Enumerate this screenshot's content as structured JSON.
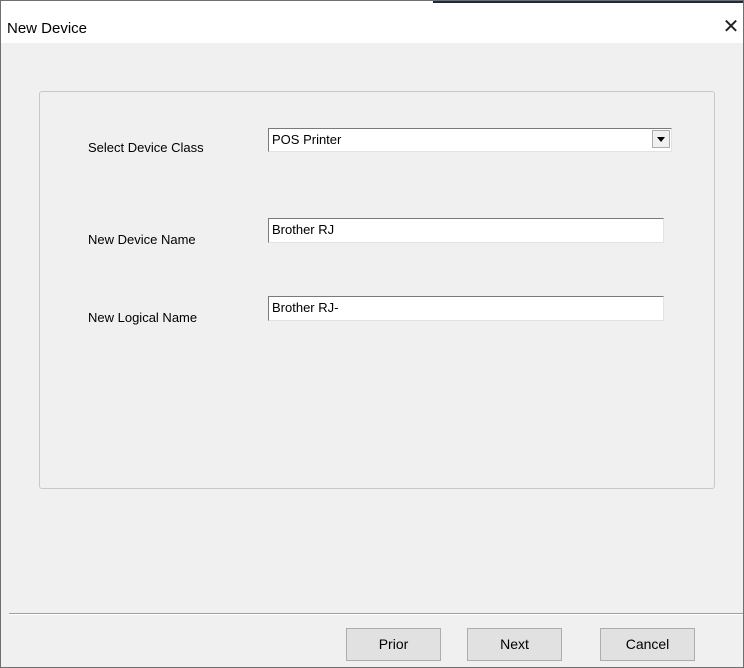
{
  "window": {
    "title": "New Device",
    "close_glyph": "✕"
  },
  "form": {
    "device_class": {
      "label": "Select Device Class",
      "value": "POS Printer"
    },
    "device_name": {
      "label": "New Device Name",
      "value": "Brother RJ"
    },
    "logical_name": {
      "label": "New Logical Name",
      "value": "Brother RJ-"
    }
  },
  "buttons": {
    "prior": "Prior",
    "next": "Next",
    "cancel": "Cancel"
  }
}
